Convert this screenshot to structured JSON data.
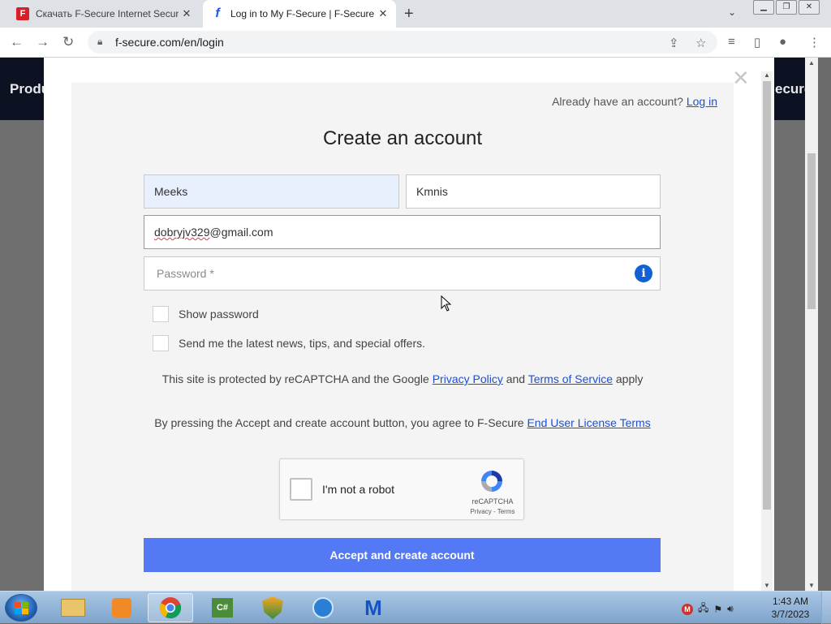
{
  "browser": {
    "tabs": [
      {
        "title": "Скачать F-Secure Internet Security",
        "active": false,
        "favicon": "f-secure-red-icon"
      },
      {
        "title": "Log in to My F-Secure | F-Secure",
        "active": true,
        "favicon": "f-secure-blue-icon"
      }
    ],
    "url": "f-secure.com/en/login"
  },
  "site_nav": {
    "left_label": "Produ",
    "right_label": "ecure"
  },
  "signup": {
    "already_text": "Already have an account?",
    "login_link": "Log in",
    "title": "Create an account",
    "first_name": "Meeks",
    "last_name": "Kmnis",
    "email_misspelled": "dobryjv329",
    "email_rest": "@gmail.com",
    "password_placeholder": "Password *",
    "show_password_label": "Show password",
    "news_label": "Send me the latest news, tips, and special offers.",
    "recaptcha_notice": {
      "prefix": "This site is protected by reCAPTCHA and the Google ",
      "privacy": "Privacy Policy",
      "and": " and ",
      "terms": "Terms of Service",
      "suffix": " apply"
    },
    "agree_notice": {
      "prefix": "By pressing the Accept and create account button, you agree to F-Secure ",
      "eula": "End User License Terms"
    },
    "recaptcha_widget": {
      "label": "I'm not a robot",
      "brand": "reCAPTCHA",
      "terms": "Privacy - Terms"
    },
    "submit_label": "Accept and create account"
  },
  "taskbar": {
    "time": "1:43 AM",
    "date": "3/7/2023"
  },
  "colors": {
    "primary_button": "#5479f5",
    "link": "#1d4fd7",
    "info_icon": "#1261d4",
    "site_nav_bg": "#0c1222"
  }
}
